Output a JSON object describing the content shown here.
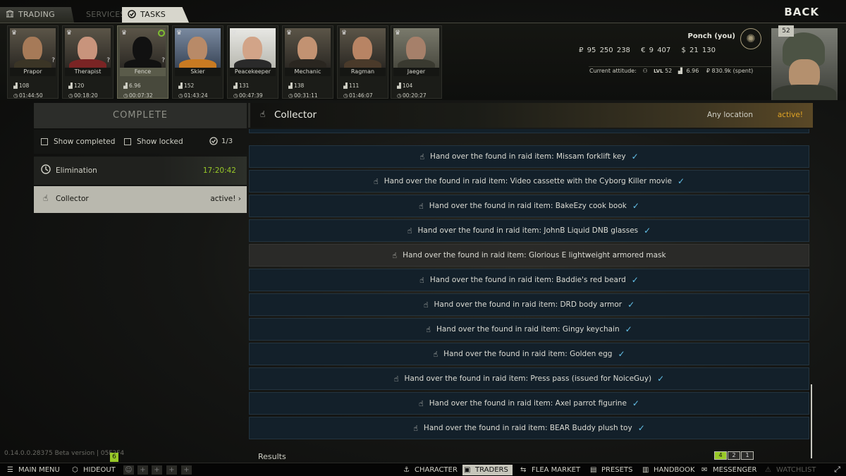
{
  "header": {
    "tabs": [
      {
        "label": "TRADING"
      },
      {
        "label": "SERVICES"
      },
      {
        "label": "TASKS"
      }
    ],
    "back_label": "BACK"
  },
  "traders": [
    {
      "name": "Prapor",
      "level": "108",
      "time": "01:44:50"
    },
    {
      "name": "Therapist",
      "level": "120",
      "time": "00:18:20"
    },
    {
      "name": "Fence",
      "level": "6.96",
      "time": "00:07:32"
    },
    {
      "name": "Skier",
      "level": "152",
      "time": "01:43:24"
    },
    {
      "name": "Peacekeeper",
      "level": "131",
      "time": "00:47:39"
    },
    {
      "name": "Mechanic",
      "level": "138",
      "time": "00:31:11"
    },
    {
      "name": "Ragman",
      "level": "111",
      "time": "01:46:07"
    },
    {
      "name": "Jaeger",
      "level": "104",
      "time": "00:20:27"
    }
  ],
  "player": {
    "name": "Ponch (you)",
    "roubles": "₽ 95 250 238",
    "euros": "€ 9 407",
    "dollars": "$ 21 130",
    "attitude_label": "Current attitude:",
    "lvl_label": "LVL",
    "lvl": "52",
    "standing": "6.96",
    "spent": "₽ 830.9k (spent)",
    "level_badge": "52"
  },
  "sidebar": {
    "section_title": "COMPLETE",
    "show_completed": "Show completed",
    "show_locked": "Show locked",
    "count": "1/3",
    "quests": [
      {
        "name": "Elimination",
        "status": "17:20:42"
      },
      {
        "name": "Collector",
        "status": "active!"
      }
    ]
  },
  "quest": {
    "title": "Collector",
    "location": "Any location",
    "status": "active!",
    "objectives": [
      {
        "text": "Hand over the found in raid item: Missam forklift key",
        "done": true
      },
      {
        "text": "Hand over the found in raid item: Video cassette with the Cyborg Killer movie",
        "done": true
      },
      {
        "text": "Hand over the found in raid item: BakeEzy cook book",
        "done": true
      },
      {
        "text": "Hand over the found in raid item: JohnB Liquid DNB glasses",
        "done": true
      },
      {
        "text": "Hand over the found in raid item: Glorious E lightweight armored mask",
        "done": false
      },
      {
        "text": "Hand over the found in raid item: Baddie's red beard",
        "done": true
      },
      {
        "text": "Hand over the found in raid item: DRD body armor",
        "done": true
      },
      {
        "text": "Hand over the found in raid item: Gingy keychain",
        "done": true
      },
      {
        "text": "Hand over the found in raid item: Golden egg",
        "done": true
      },
      {
        "text": "Hand over the found in raid item: Press pass (issued for NoiceGuy)",
        "done": true
      },
      {
        "text": "Hand over the found in raid item: Axel parrot figurine",
        "done": true
      },
      {
        "text": "Hand over the found in raid item: BEAR Buddy plush toy",
        "done": true
      }
    ],
    "results_label": "Results",
    "reward_icons": [
      "4",
      "2",
      "1"
    ]
  },
  "version": "0.14.0.0.28375 Beta version | 05F2F4",
  "bottombar": {
    "main_menu": "MAIN MENU",
    "hideout": "HIDEOUT",
    "hideout_badge": "6",
    "character": "CHARACTER",
    "traders": "TRADERS",
    "flea_market": "FLEA MARKET",
    "presets": "PRESETS",
    "handbook": "HANDBOOK",
    "messenger": "MESSENGER",
    "watchlist": "WATCHLIST"
  },
  "colors": {
    "accent_green": "#98c828",
    "active_orange": "#e0a424",
    "check_blue": "#64c0e8"
  }
}
